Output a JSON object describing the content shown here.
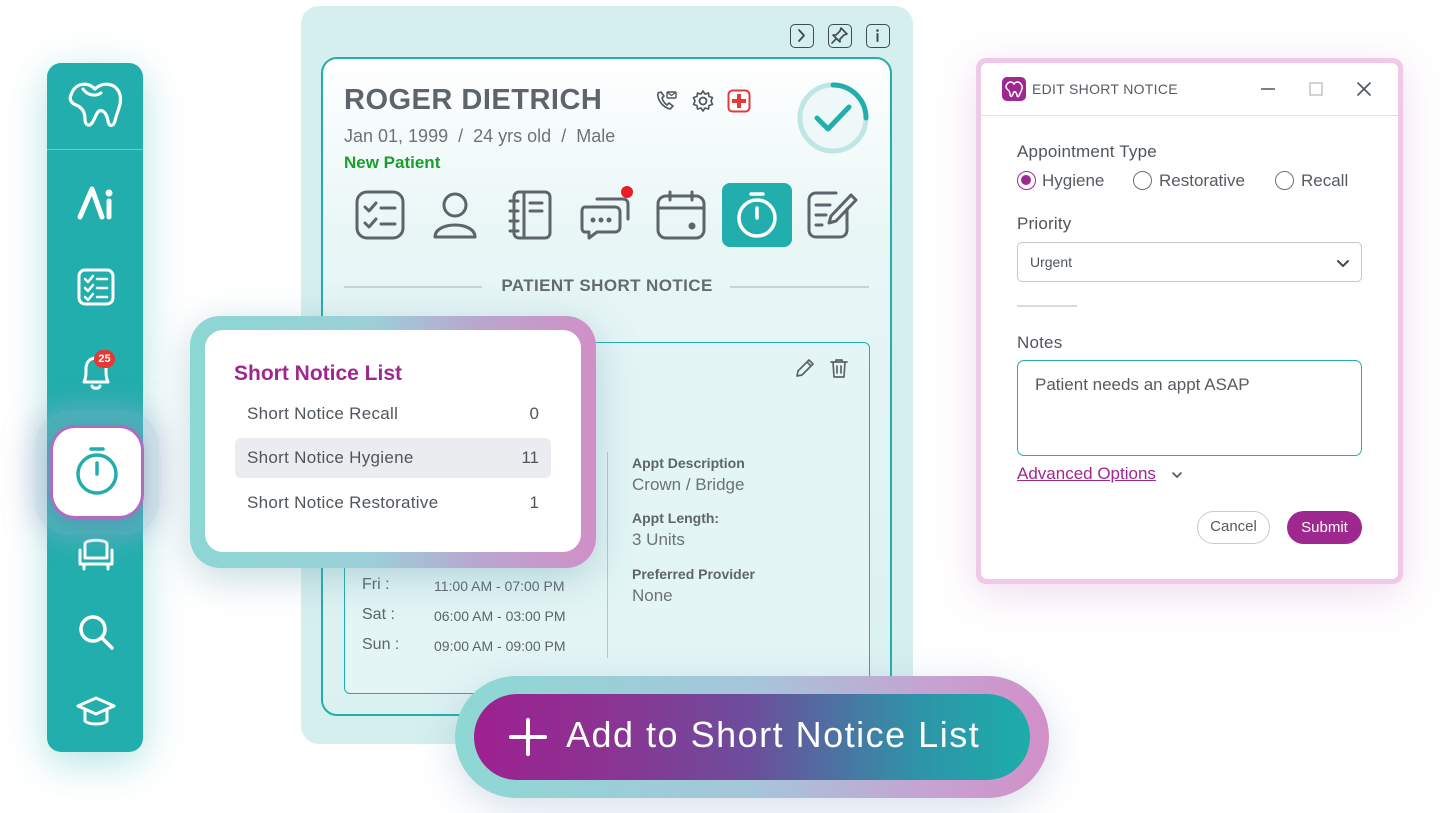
{
  "patient": {
    "name": "ROGER DIETRICH",
    "dob": "Jan 01, 1999",
    "age": "24 yrs old",
    "sex": "Male",
    "separator": "/",
    "status": "New Patient"
  },
  "sidebar": {
    "notification_count": "25",
    "items": [
      "logo",
      "ai",
      "checklist",
      "notifications",
      "short-notice-timer",
      "chair",
      "search",
      "education"
    ]
  },
  "section": {
    "title": "PATIENT SHORT NOTICE"
  },
  "appointment": {
    "description_label": "Appt Description",
    "description_value": "Crown / Bridge",
    "length_label": "Appt Length:",
    "length_value": "3 Units",
    "provider_label": "Preferred Provider",
    "provider_value": "None"
  },
  "schedule": [
    {
      "day": "Fri :",
      "hours": "11:00 AM - 07:00 PM"
    },
    {
      "day": "Sat :",
      "hours": "06:00 AM - 03:00 PM"
    },
    {
      "day": "Sun :",
      "hours": "09:00 AM - 09:00 PM"
    }
  ],
  "short_notice_list": {
    "title": "Short Notice List",
    "items": [
      {
        "label": "Short Notice Recall",
        "count": "0"
      },
      {
        "label": "Short Notice Hygiene",
        "count": "11"
      },
      {
        "label": "Short Notice Restorative",
        "count": "1"
      }
    ]
  },
  "dialog": {
    "title": "EDIT SHORT NOTICE",
    "appointment_type_label": "Appointment Type",
    "options": [
      "Hygiene",
      "Restorative",
      "Recall"
    ],
    "selected_option": "Hygiene",
    "priority_label": "Priority",
    "priority_value": "Urgent",
    "notes_label": "Notes",
    "notes_value": "Patient needs an appt ASAP",
    "advanced_label": "Advanced Options",
    "cancel_label": "Cancel",
    "submit_label": "Submit"
  },
  "cta": {
    "label": "Add to Short Notice List"
  },
  "colors": {
    "teal": "#22aeac",
    "magenta": "#9e2890",
    "status_green": "#1c9e2c",
    "alert_red": "#e53935"
  }
}
